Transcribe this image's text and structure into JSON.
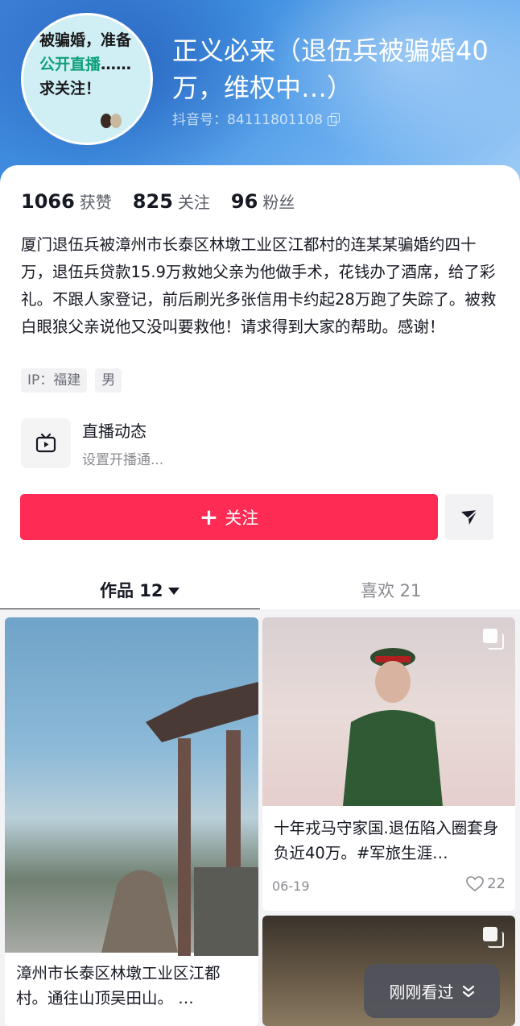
{
  "profile": {
    "avatar_text_1": "被骗婚，准备",
    "avatar_text_highlight": "公开直播",
    "avatar_text_2": "……求关注！",
    "name": "正义必来（退伍兵被骗婚40万，维权中…）",
    "douyin_id": "抖音号：84111801108"
  },
  "stats": {
    "likes_count": "1066",
    "likes_label": "获赞",
    "following_count": "825",
    "following_label": "关注",
    "fans_count": "96",
    "fans_label": "粉丝"
  },
  "bio": "厦门退伍兵被漳州市长泰区林墩工业区江都村的连某某骗婚约四十万，退伍兵贷款15.9万救她父亲为他做手术，花钱办了酒席，给了彩礼。不跟人家登记，前后刷光多张信用卡约起28万跑了失踪了。被救白眼狼父亲说他又没叫要救他！请求得到大家的帮助。感谢！",
  "tags": [
    "IP：福建",
    "男"
  ],
  "live": {
    "title": "直播动态",
    "subtitle": "设置开播通..."
  },
  "actions": {
    "follow_label": "关注"
  },
  "tabs": {
    "works": "作品 12",
    "likes": "喜欢 21"
  },
  "posts": [
    {
      "caption": "漳州市长泰区林墩工业区江都村。通往山顶吴田山。 …"
    },
    {
      "caption": "十年戎马守家国.退伍陷入圈套身负近40万。#军旅生涯…",
      "date": "06-19",
      "likes": "22"
    },
    {
      "caption": ""
    }
  ],
  "recent": {
    "label": "刚刚看过"
  },
  "colors": {
    "primary": "#fe2c55",
    "text": "#161823",
    "muted": "#8a8b91"
  }
}
